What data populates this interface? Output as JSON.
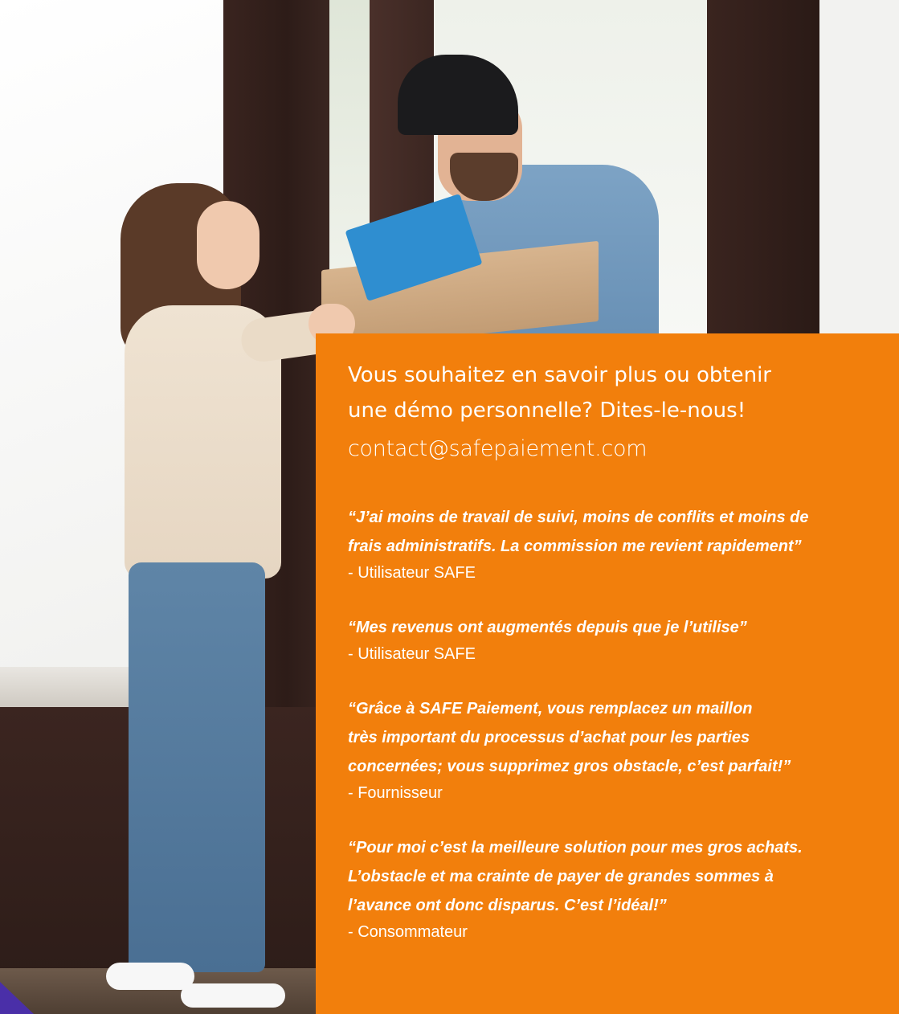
{
  "contact": {
    "headline_line1": "Vous souhaitez en savoir plus ou obtenir",
    "headline_line2": "une démo personnelle? Dites-le-nous!",
    "email": "contact@safepaiement.com"
  },
  "testimonials": [
    {
      "lines": [
        "“J’ai moins de travail de suivi, moins de conflits et moins de",
        "frais administratifs. La commission me revient rapidement”"
      ],
      "author": "- Utilisateur SAFE"
    },
    {
      "lines": [
        "“Mes revenus ont augmentés depuis que je l’utilise”"
      ],
      "author": "- Utilisateur SAFE"
    },
    {
      "lines": [
        "“Grâce à SAFE Paiement, vous remplacez un maillon",
        "très important du processus d’achat pour les parties",
        "concernées; vous supprimez gros obstacle, c’est parfait!”"
      ],
      "author": "- Fournisseur"
    },
    {
      "lines": [
        "“Pour moi c’est la meilleure solution pour mes gros achats.",
        "L’obstacle et ma crainte de payer de grandes sommes à",
        "l’avance ont donc disparus. C’est l’idéal!”"
      ],
      "author": "- Consommateur"
    }
  ],
  "colors": {
    "panel": "#f27f0c",
    "text": "#ffffff",
    "accent": "#4a2fa8"
  }
}
